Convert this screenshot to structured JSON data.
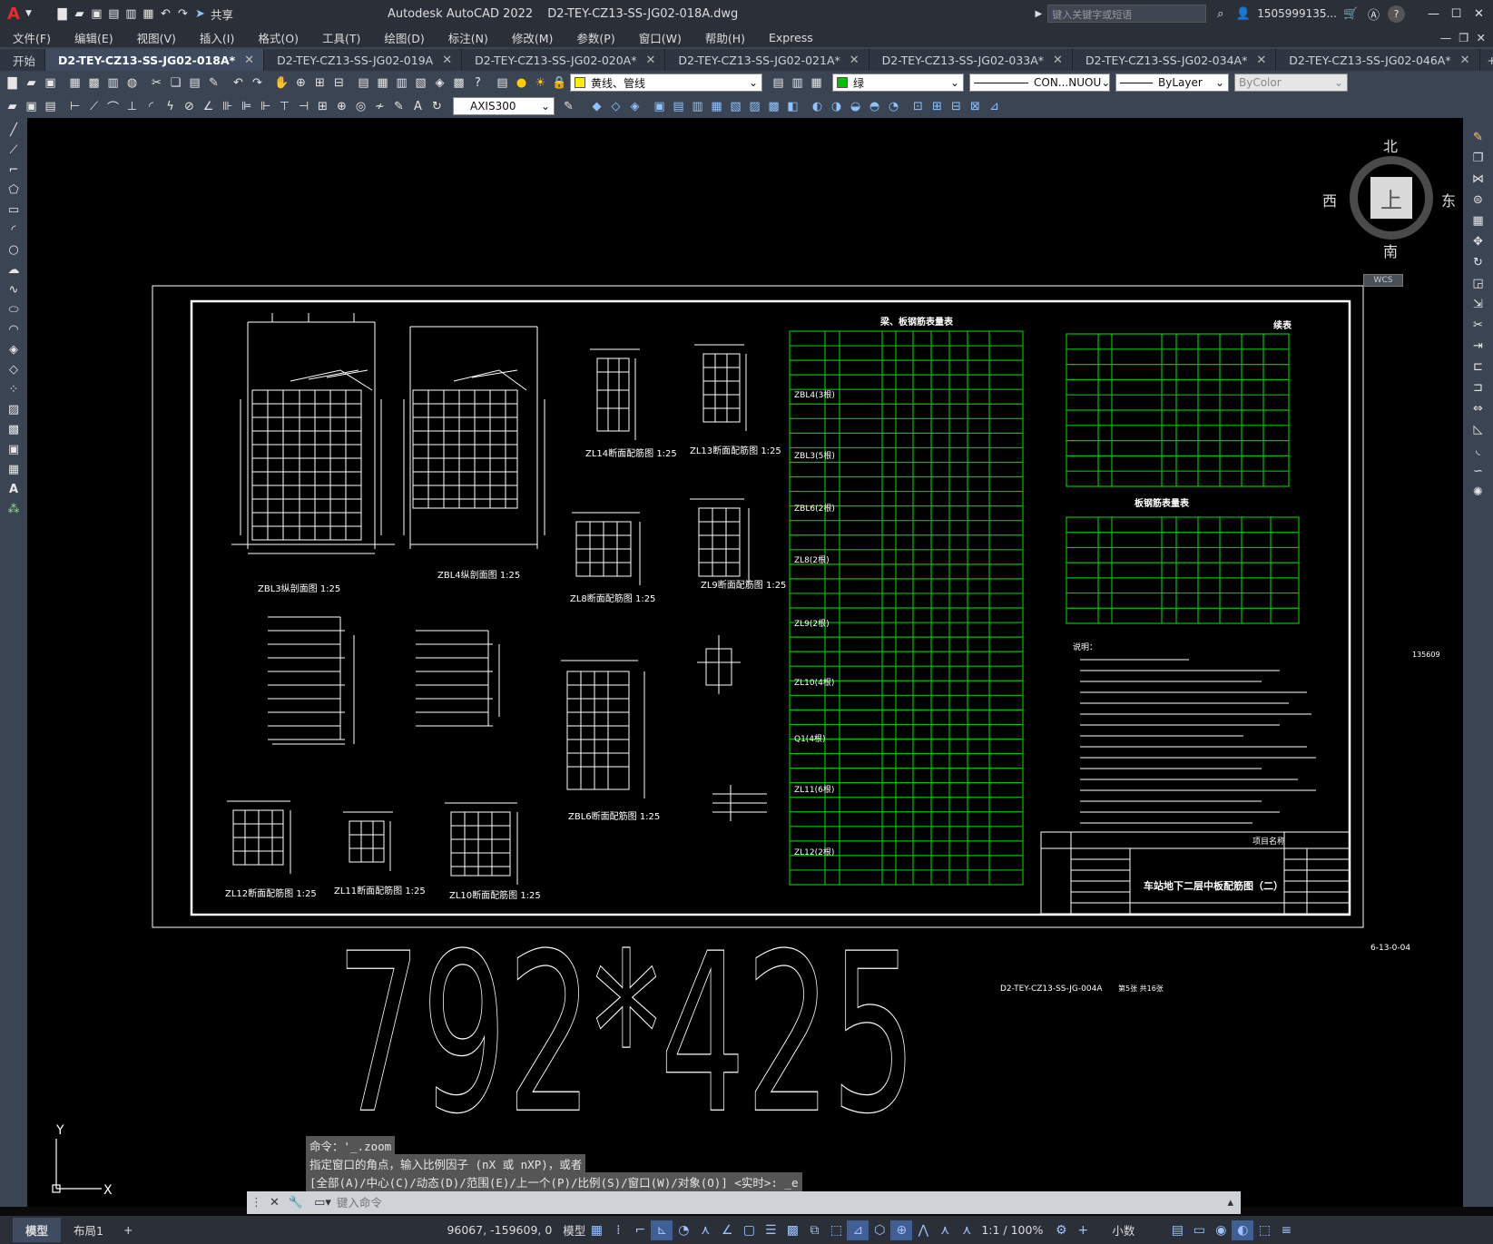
{
  "app": {
    "logo": "A",
    "title": "Autodesk AutoCAD 2022",
    "file": "D2-TEY-CZ13-SS-JG02-018A.dwg",
    "share": "共享",
    "search_placeholder": "键入关键字或短语",
    "user": "1505999135...",
    "help": "?"
  },
  "menu": [
    "文件(F)",
    "编辑(E)",
    "视图(V)",
    "插入(I)",
    "格式(O)",
    "工具(T)",
    "绘图(D)",
    "标注(N)",
    "修改(M)",
    "参数(P)",
    "窗口(W)",
    "帮助(H)",
    "Express"
  ],
  "tabs": [
    {
      "label": "开始"
    },
    {
      "label": "D2-TEY-CZ13-SS-JG02-018A*"
    },
    {
      "label": "D2-TEY-CZ13-SS-JG02-019A"
    },
    {
      "label": "D2-TEY-CZ13-SS-JG02-020A*"
    },
    {
      "label": "D2-TEY-CZ13-SS-JG02-021A*"
    },
    {
      "label": "D2-TEY-CZ13-SS-JG02-033A*"
    },
    {
      "label": "D2-TEY-CZ13-SS-JG02-034A*"
    },
    {
      "label": "D2-TEY-CZ13-SS-JG02-046A*"
    }
  ],
  "toolbar": {
    "layer": "黄线、管线",
    "color": "绿",
    "linetype": "CON...NUOU",
    "lineweight": "ByLayer",
    "plotstyle": "ByColor",
    "dimstyle": "AXIS300"
  },
  "viewcube": {
    "north": "北",
    "south": "南",
    "east": "东",
    "west": "西",
    "top": "上",
    "wcs": "WCS"
  },
  "drawing": {
    "big_text": "792*425",
    "sheet_code": "6-13-0-04",
    "ref_label": "D2-TEY-CZ13-SS-JG-004A",
    "ref_small": "第5张 共16张",
    "side_number": "135609",
    "table1_title": "梁、板钢筋表量表",
    "table2_title": "续表",
    "table3_title": "板钢筋表量表",
    "title_block": "车站地下二层中板配筋图（二）",
    "project": "项目名称",
    "section_labels": [
      "ZBL3纵剖面图 1:25",
      "ZBL4纵剖面图 1:25",
      "ZL14断面配筋图 1:25",
      "ZL13断面配筋图 1:25",
      "ZL8断面配筋图 1:25",
      "ZL9断面配筋图 1:25",
      "ZBL6断面配筋图 1:25",
      "ZL12断面配筋图 1:25",
      "ZL11断面配筋图 1:25",
      "ZL10断面配筋图 1:25"
    ],
    "beam_groups": [
      "ZBL4(3根)",
      "ZBL3(5根)",
      "ZBL6(2根)",
      "ZL8(2根)",
      "ZL9(2根)",
      "ZL10(4根)",
      "Q1(4根)",
      "ZL11(6根)",
      "ZL12(2根)"
    ],
    "notes_title": "说明："
  },
  "command": {
    "history": [
      "命令：'_.zoom",
      "指定窗口的角点，输入比例因子 (nX 或 nXP)，或者",
      "[全部(A)/中心(C)/动态(D)/范围(E)/上一个(P)/比例(S)/窗口(W)/对象(O)] <实时>: _e"
    ],
    "placeholder": "键入命令"
  },
  "status": {
    "tabs": [
      "模型",
      "布局1"
    ],
    "coords": "96067, -159609, 0",
    "model": "模型",
    "scale": "1:1 / 100%",
    "units": "小数"
  },
  "colors": {
    "green_table": "#00c000",
    "white": "#ffffff",
    "bg": "#000000",
    "accent": "#2b5fb3"
  }
}
